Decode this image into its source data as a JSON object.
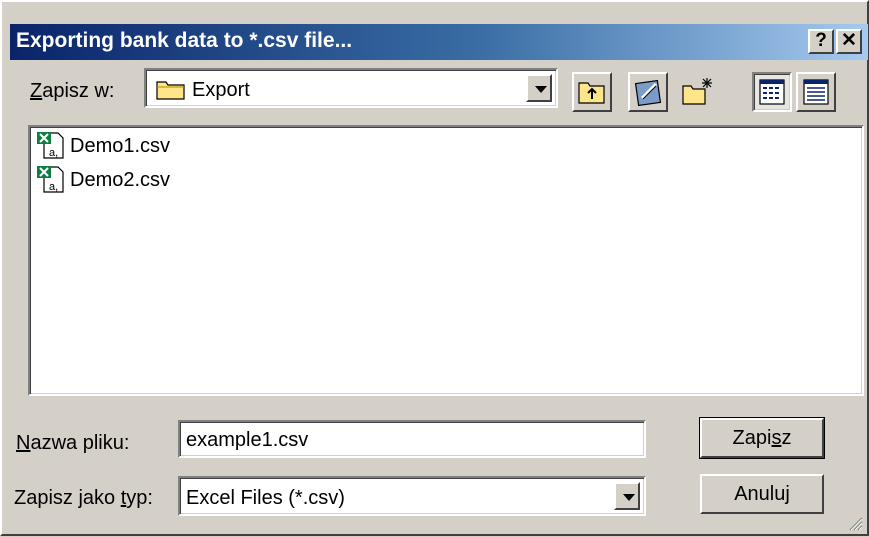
{
  "dialog": {
    "title": "Exporting bank data to *.csv file...",
    "help_label": "?",
    "close_label": "✕"
  },
  "save_in": {
    "label_first": "Z",
    "label_rest": "apisz w:",
    "folder": "Export"
  },
  "toolbar": {
    "icons": [
      "up-folder-icon",
      "desktop-icon",
      "new-folder-icon",
      "list-view-icon",
      "details-view-icon"
    ]
  },
  "files": [
    {
      "name": "Demo1.csv"
    },
    {
      "name": "Demo2.csv"
    }
  ],
  "filename": {
    "label_first": "N",
    "label_rest": "azwa pliku:",
    "value": "example1.csv"
  },
  "filetype": {
    "label_pre": "Zapisz jako ",
    "label_ul": "t",
    "label_post": "yp:",
    "value": "Excel Files (*.csv)"
  },
  "buttons": {
    "save_pre": "Zapi",
    "save_ul": "s",
    "save_post": "z",
    "cancel": "Anuluj"
  },
  "colors": {
    "title_active": "#0a246a",
    "face": "#d4d0c8",
    "excel_green": "#107c41"
  }
}
